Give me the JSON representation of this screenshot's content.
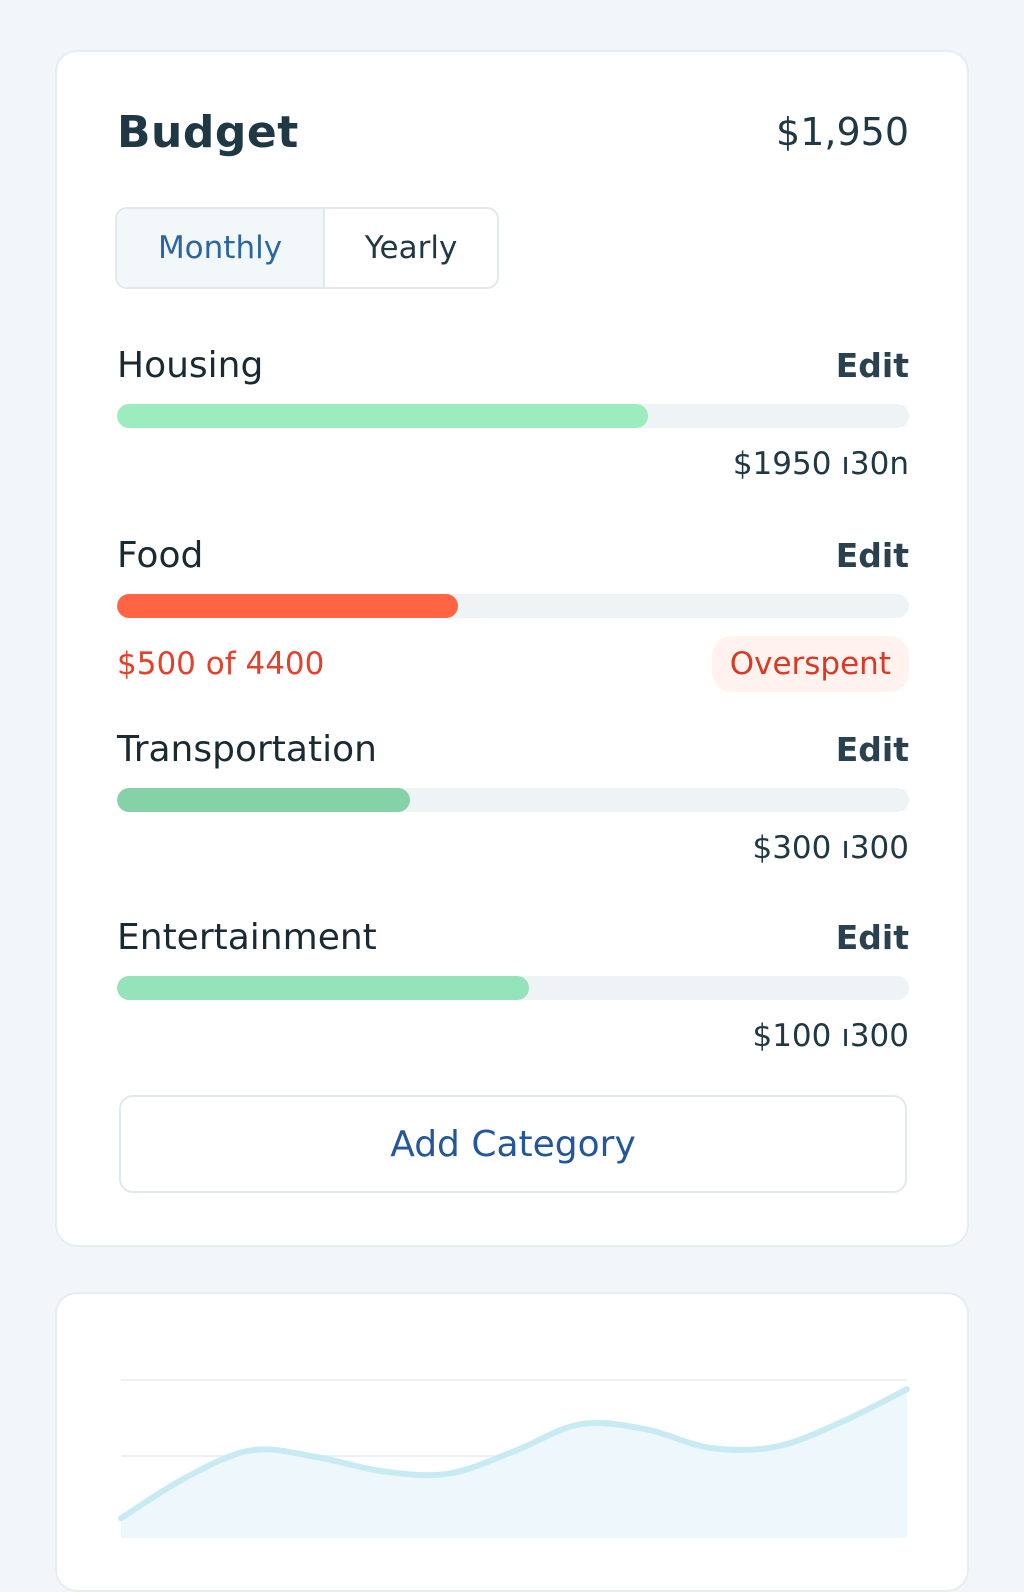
{
  "budget": {
    "title": "Budget",
    "total": "$1,950",
    "tabs": [
      {
        "label": "Monthly",
        "active": true
      },
      {
        "label": "Yearly",
        "active": false
      }
    ],
    "edit_label": "Edit",
    "categories": [
      {
        "name": "Housing",
        "amount": "$1950 ı30n",
        "progress": 0.67,
        "color": "#9decbe"
      },
      {
        "name": "Food",
        "amount": "$500 of 4400",
        "progress": 0.43,
        "color": "#ff6543",
        "overspent": true,
        "status": "Overspent"
      },
      {
        "name": "Transportation",
        "amount": "$300 ı300",
        "progress": 0.37,
        "color": "#86d1a8"
      },
      {
        "name": "Entertainment",
        "amount": "$100 ı300",
        "progress": 0.52,
        "color": "#95e3bb"
      }
    ],
    "add_label": "Add Category"
  },
  "colors": {
    "accent": "#2b66a3",
    "danger": "#e2412c",
    "line": "#c8ebf3"
  },
  "chart_data": {
    "type": "area",
    "title": "",
    "xlabel": "",
    "ylabel": "",
    "x": [
      0,
      1,
      2,
      3,
      4,
      5,
      6,
      7,
      8,
      9,
      10,
      11,
      12
    ],
    "series": [
      {
        "values": [
          10,
          45,
          68,
          62,
          50,
          48,
          67,
          90,
          86,
          70,
          71,
          92,
          120
        ]
      }
    ],
    "ylim": [
      0,
      150
    ],
    "grid": true,
    "legend": "none"
  }
}
